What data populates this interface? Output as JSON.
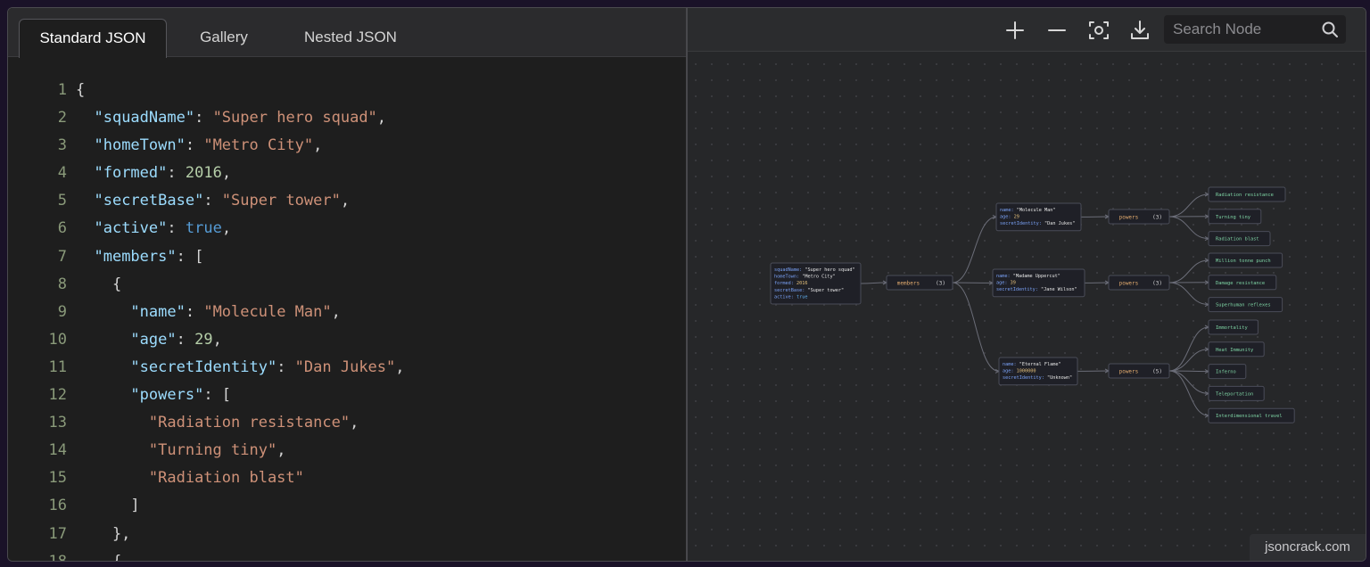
{
  "tabs": [
    "Standard JSON",
    "Gallery",
    "Nested JSON"
  ],
  "editor": {
    "lines": [
      {
        "n": "1",
        "t": "{"
      },
      {
        "n": "2",
        "t": "  \"squadName\": \"Super hero squad\","
      },
      {
        "n": "3",
        "t": "  \"homeTown\": \"Metro City\","
      },
      {
        "n": "4",
        "t": "  \"formed\": 2016,"
      },
      {
        "n": "5",
        "t": "  \"secretBase\": \"Super tower\","
      },
      {
        "n": "6",
        "t": "  \"active\": true,"
      },
      {
        "n": "7",
        "t": "  \"members\": ["
      },
      {
        "n": "8",
        "t": "    {"
      },
      {
        "n": "9",
        "t": "      \"name\": \"Molecule Man\","
      },
      {
        "n": "10",
        "t": "      \"age\": 29,"
      },
      {
        "n": "11",
        "t": "      \"secretIdentity\": \"Dan Jukes\","
      },
      {
        "n": "12",
        "t": "      \"powers\": ["
      },
      {
        "n": "13",
        "t": "        \"Radiation resistance\","
      },
      {
        "n": "14",
        "t": "        \"Turning tiny\","
      },
      {
        "n": "15",
        "t": "        \"Radiation blast\""
      },
      {
        "n": "16",
        "t": "      ]"
      },
      {
        "n": "17",
        "t": "    },"
      },
      {
        "n": "18",
        "t": "    {"
      }
    ]
  },
  "toolbar": {
    "search_placeholder": "Search Node",
    "icons": [
      "plus-icon",
      "minus-icon",
      "focus-icon",
      "download-icon",
      "search-icon"
    ]
  },
  "graph": {
    "root": [
      {
        "k": "squadName",
        "v": "\"Super hero squad\""
      },
      {
        "k": "homeTown",
        "v": "\"Metro City\""
      },
      {
        "k": "formed",
        "v": "2016"
      },
      {
        "k": "secretBase",
        "v": "\"Super tower\""
      },
      {
        "k": "active",
        "v": "true"
      }
    ],
    "members_label": "members",
    "members_count": "(3)",
    "members": [
      {
        "rows": [
          {
            "k": "name",
            "v": "\"Molecule Man\""
          },
          {
            "k": "age",
            "v": "29"
          },
          {
            "k": "secretIdentity",
            "v": "\"Dan Jukes\""
          }
        ],
        "powers_label": "powers",
        "powers_count": "(3)",
        "powers": [
          "Radiation resistance",
          "Turning tiny",
          "Radiation blast"
        ]
      },
      {
        "rows": [
          {
            "k": "name",
            "v": "\"Madame Uppercut\""
          },
          {
            "k": "age",
            "v": "39"
          },
          {
            "k": "secretIdentity",
            "v": "\"Jane Wilson\""
          }
        ],
        "powers_label": "powers",
        "powers_count": "(3)",
        "powers": [
          "Million tonne punch",
          "Damage resistance",
          "Superhuman reflexes"
        ]
      },
      {
        "rows": [
          {
            "k": "name",
            "v": "\"Eternal Flame\""
          },
          {
            "k": "age",
            "v": "1000000"
          },
          {
            "k": "secretIdentity",
            "v": "\"Unknown\""
          }
        ],
        "powers_label": "powers",
        "powers_count": "(5)",
        "powers": [
          "Immortality",
          "Heat Immunity",
          "Inferno",
          "Teleportation",
          "Interdimensional travel"
        ]
      }
    ]
  },
  "watermark": "jsoncrack.com",
  "colors": {
    "key": "#9cdcfe",
    "string": "#ce9178",
    "number": "#b5cea8",
    "boolean": "#569cd6",
    "node_key": "#7aa2f7",
    "node_number": "#e5c07b",
    "node_bool": "#61afef",
    "parent_label": "#e0a96d",
    "leaf_text": "#7ed4a4"
  }
}
